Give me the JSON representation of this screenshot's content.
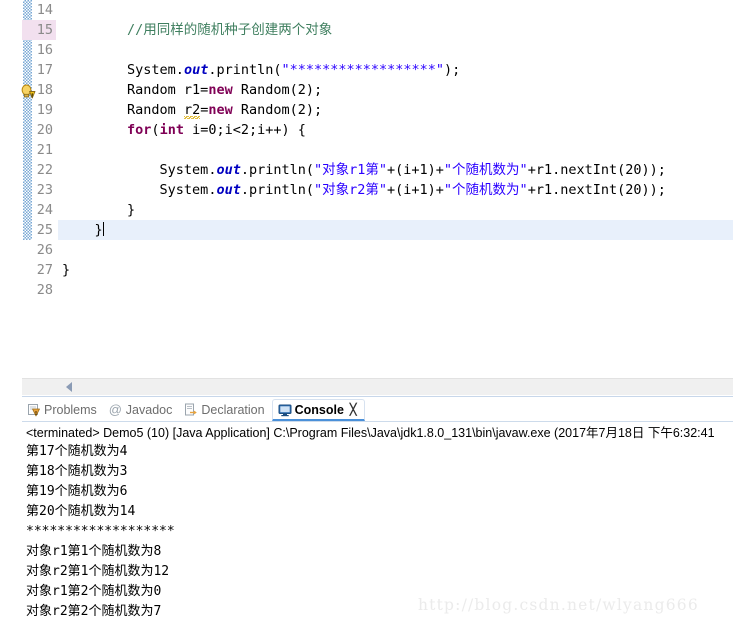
{
  "editor": {
    "first_visible_line": 14,
    "current_line": 25,
    "warning_line": 19,
    "highlight_line": 15,
    "change_bar_from": 14,
    "change_bar_to": 25,
    "colors": {
      "comment": "#3f7f5f",
      "keyword": "#7f0055",
      "string": "#2a00ff",
      "field": "#0000c0",
      "current_line_bg": "#e8f0fb",
      "change_bar": "#7aa8d4",
      "line_number": "#8a8a8a"
    },
    "lines": [
      {
        "num": "14",
        "segs": []
      },
      {
        "num": "15",
        "segs": [
          {
            "t": "        ",
            "c": "tok-plain"
          },
          {
            "t": "//用同样的随机种子创建两个对象",
            "c": "tok-cmt"
          }
        ]
      },
      {
        "num": "16",
        "segs": []
      },
      {
        "num": "17",
        "segs": [
          {
            "t": "        ",
            "c": "tok-plain"
          },
          {
            "t": "System.",
            "c": "tok-plain"
          },
          {
            "t": "out",
            "c": "tok-fld"
          },
          {
            "t": ".println(",
            "c": "tok-plain"
          },
          {
            "t": "\"******************\"",
            "c": "tok-str"
          },
          {
            "t": ");",
            "c": "tok-plain"
          }
        ]
      },
      {
        "num": "18",
        "segs": [
          {
            "t": "        ",
            "c": "tok-plain"
          },
          {
            "t": "Random r1=",
            "c": "tok-plain"
          },
          {
            "t": "new",
            "c": "tok-kw"
          },
          {
            "t": " Random(2);",
            "c": "tok-plain"
          }
        ]
      },
      {
        "num": "19",
        "segs": [
          {
            "t": "        ",
            "c": "tok-plain"
          },
          {
            "t": "Random ",
            "c": "tok-plain"
          },
          {
            "t": "r2",
            "c": "warnvar"
          },
          {
            "t": "=",
            "c": "tok-plain"
          },
          {
            "t": "new",
            "c": "tok-kw"
          },
          {
            "t": " Random(2);",
            "c": "tok-plain"
          }
        ]
      },
      {
        "num": "20",
        "segs": [
          {
            "t": "        ",
            "c": "tok-plain"
          },
          {
            "t": "for",
            "c": "tok-kw"
          },
          {
            "t": "(",
            "c": "tok-plain"
          },
          {
            "t": "int",
            "c": "tok-kw"
          },
          {
            "t": " i=0;i<2;i++) {",
            "c": "tok-plain"
          }
        ]
      },
      {
        "num": "21",
        "segs": []
      },
      {
        "num": "22",
        "segs": [
          {
            "t": "            ",
            "c": "tok-plain"
          },
          {
            "t": "System.",
            "c": "tok-plain"
          },
          {
            "t": "out",
            "c": "tok-fld"
          },
          {
            "t": ".println(",
            "c": "tok-plain"
          },
          {
            "t": "\"对象r1第\"",
            "c": "tok-str"
          },
          {
            "t": "+(i+1)+",
            "c": "tok-plain"
          },
          {
            "t": "\"个随机数为\"",
            "c": "tok-str"
          },
          {
            "t": "+r1.nextInt(20));",
            "c": "tok-plain"
          }
        ]
      },
      {
        "num": "23",
        "segs": [
          {
            "t": "            ",
            "c": "tok-plain"
          },
          {
            "t": "System.",
            "c": "tok-plain"
          },
          {
            "t": "out",
            "c": "tok-fld"
          },
          {
            "t": ".println(",
            "c": "tok-plain"
          },
          {
            "t": "\"对象r2第\"",
            "c": "tok-str"
          },
          {
            "t": "+(i+1)+",
            "c": "tok-plain"
          },
          {
            "t": "\"个随机数为\"",
            "c": "tok-str"
          },
          {
            "t": "+r1.nextInt(20));",
            "c": "tok-plain"
          }
        ]
      },
      {
        "num": "24",
        "segs": [
          {
            "t": "        }",
            "c": "tok-plain"
          }
        ]
      },
      {
        "num": "25",
        "segs": [
          {
            "t": "    }",
            "c": "tok-plain"
          }
        ],
        "current": true,
        "caret": true
      },
      {
        "num": "26",
        "segs": []
      },
      {
        "num": "27",
        "segs": [
          {
            "t": "}",
            "c": "tok-plain"
          }
        ]
      },
      {
        "num": "28",
        "segs": []
      }
    ]
  },
  "scrollbar": {
    "left_arrow_icon": "triangle-left-icon"
  },
  "bottom_panel": {
    "tabs": [
      {
        "label": "Problems",
        "icon": "problems-icon",
        "active": false,
        "closable": false
      },
      {
        "label": "Javadoc",
        "icon": "javadoc-at-icon",
        "active": false,
        "closable": false
      },
      {
        "label": "Declaration",
        "icon": "declaration-icon",
        "active": false,
        "closable": false
      },
      {
        "label": "Console",
        "icon": "console-monitor-icon",
        "active": true,
        "closable": true,
        "close_glyph": "╳"
      }
    ],
    "console": {
      "terminated_line": "<terminated> Demo5 (10) [Java Application] C:\\Program Files\\Java\\jdk1.8.0_131\\bin\\javaw.exe (2017年7月18日 下午6:32:41",
      "output": [
        "第17个随机数为4",
        "第18个随机数为3",
        "第19个随机数为6",
        "第20个随机数为14",
        "*******************",
        "对象r1第1个随机数为8",
        "对象r2第1个随机数为12",
        "对象r1第2个随机数为0",
        "对象r2第2个随机数为7"
      ]
    }
  },
  "watermark": {
    "text": "http://blog.csdn.net/wlyang666"
  }
}
